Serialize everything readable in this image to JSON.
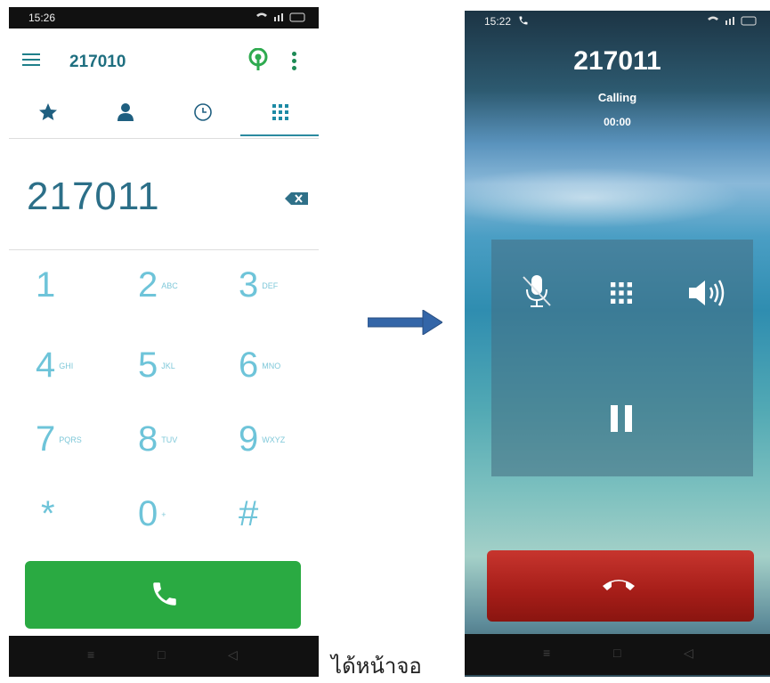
{
  "left_phone": {
    "status_time": "15:26",
    "status_icons": "▼ ⵏⵏ ▭",
    "account": "217010",
    "dialed_number": "217011",
    "keys": [
      {
        "digit": "1",
        "letters": ""
      },
      {
        "digit": "2",
        "letters": "ABC"
      },
      {
        "digit": "3",
        "letters": "DEF"
      },
      {
        "digit": "4",
        "letters": "GHI"
      },
      {
        "digit": "5",
        "letters": "JKL"
      },
      {
        "digit": "6",
        "letters": "MNO"
      },
      {
        "digit": "7",
        "letters": "PQRS"
      },
      {
        "digit": "8",
        "letters": "TUV"
      },
      {
        "digit": "9",
        "letters": "WXYZ"
      },
      {
        "digit": "*",
        "letters": ""
      },
      {
        "digit": "0",
        "letters": "+"
      },
      {
        "digit": "#",
        "letters": ""
      }
    ],
    "tabs": [
      "favorites-icon",
      "contacts-icon",
      "recents-icon",
      "dialpad-icon"
    ],
    "accent_color": "#2b8aa0",
    "call_color": "#2aaa42"
  },
  "caption": "ได้หน้าจอ",
  "right_phone": {
    "status_time": "15:22",
    "callee": "217011",
    "call_status": "Calling",
    "timer": "00:00",
    "controls": [
      "mute-icon",
      "dialpad-icon",
      "speaker-icon",
      "hold-icon"
    ],
    "end_color": "#b22620"
  }
}
